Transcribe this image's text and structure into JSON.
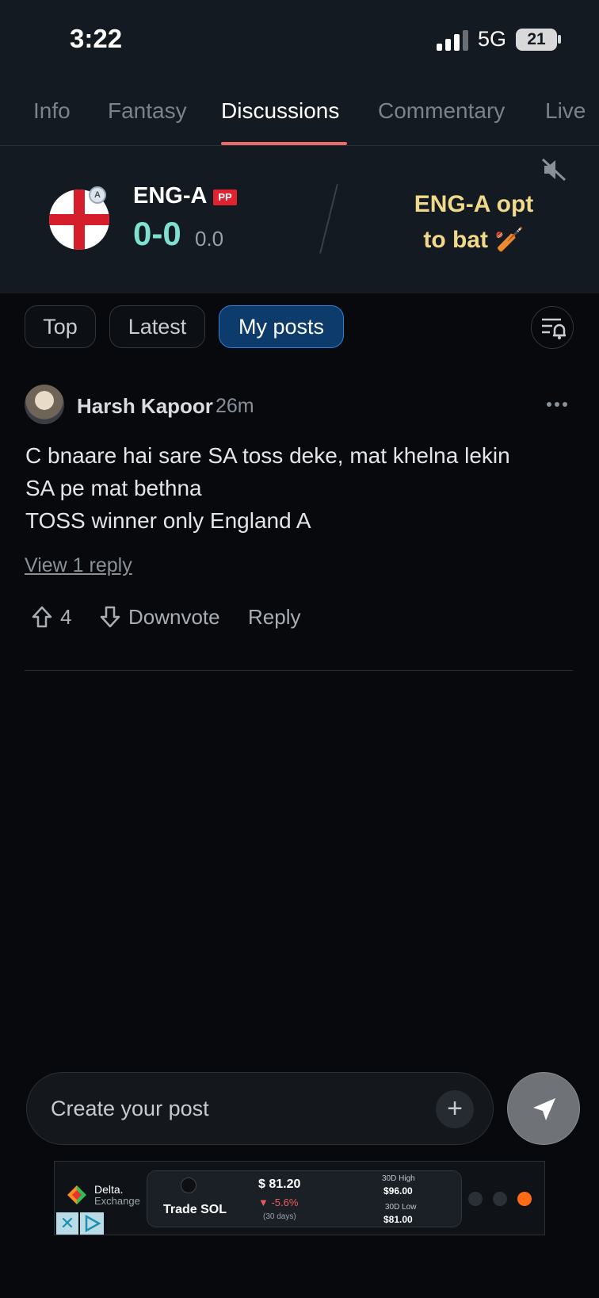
{
  "status_bar": {
    "time": "3:22",
    "network": "5G",
    "battery": "21"
  },
  "tabs": [
    {
      "label": "Info"
    },
    {
      "label": "Fantasy"
    },
    {
      "label": "Discussions",
      "active": true
    },
    {
      "label": "Commentary"
    },
    {
      "label": "Live"
    }
  ],
  "match": {
    "team": "ENG-A",
    "badge": "PP",
    "flag_badge": "A",
    "score": "0-0",
    "overs": "0.0",
    "toss_line1": "ENG-A opt",
    "toss_line2": "to bat 🏏"
  },
  "filters": [
    {
      "label": "Top"
    },
    {
      "label": "Latest"
    },
    {
      "label": "My posts",
      "active": true
    }
  ],
  "post": {
    "author": "Harsh Kapoor",
    "time_ago": "26m",
    "body_lines": [
      "C bnaare hai sare SA toss deke, mat khelna lekin",
      "SA pe mat bethna",
      "TOSS winner only England A"
    ],
    "view_reply": "View 1 reply",
    "upvotes": "4",
    "downvote_label": "Downvote",
    "reply_label": "Reply"
  },
  "composer": {
    "placeholder": "Create your post",
    "plus": "+"
  },
  "ad": {
    "brand_line1": "Delta.",
    "brand_line2": "Exchange",
    "close": "✕",
    "cta": "Trade SOL",
    "price": "$ 81.20",
    "change": "▼ -5.6%",
    "period": "(30 days)",
    "high_label": "30D High",
    "high_value": "$96.00",
    "low_label": "30D Low",
    "low_value": "$81.00"
  },
  "colors": {
    "accent_tab": "#e86a6a",
    "score": "#7ee0d0",
    "toss": "#f1d98a",
    "chip_active": "#0d3b6b"
  }
}
